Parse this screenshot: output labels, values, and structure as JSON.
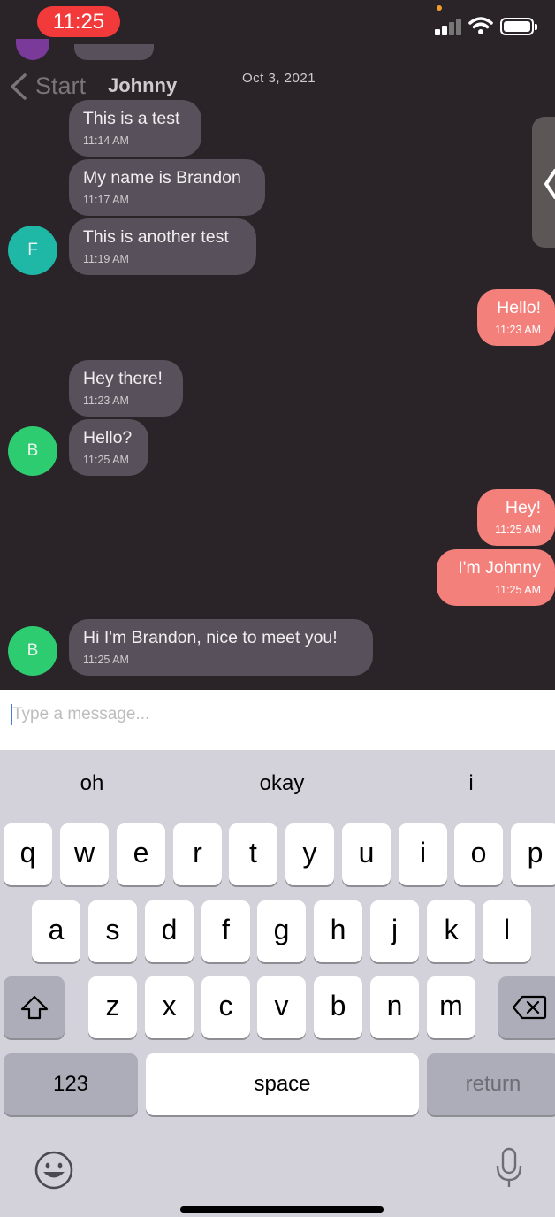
{
  "status_bar": {
    "time": "11:25"
  },
  "header": {
    "back_label": "Start",
    "title": "Johnny",
    "date": "Oct 3, 2021"
  },
  "messages": [
    {
      "side": "in",
      "text": "This is a test",
      "time": "11:14 AM"
    },
    {
      "side": "in",
      "text": "My name is Brandon",
      "time": "11:17 AM"
    },
    {
      "side": "in",
      "text": "This is another test",
      "time": "11:19 AM",
      "avatar": "F"
    },
    {
      "side": "out",
      "text": "Hello!",
      "time": "11:23 AM"
    },
    {
      "side": "in",
      "text": "Hey there!",
      "time": "11:23 AM"
    },
    {
      "side": "in",
      "text": "Hello?",
      "time": "11:25 AM",
      "avatar": "B"
    },
    {
      "side": "out",
      "text": "Hey!",
      "time": "11:25 AM"
    },
    {
      "side": "out",
      "text": "I'm Johnny",
      "time": "11:25 AM"
    },
    {
      "side": "in",
      "text": "Hi I'm Brandon, nice to meet you!",
      "time": "11:25 AM",
      "avatar": "B"
    }
  ],
  "colors": {
    "incoming": "#58505a",
    "outgoing": "#f3807a",
    "avatar_f": "#1fb8a6",
    "avatar_b": "#2ecc71",
    "background": "#2a2328"
  },
  "input": {
    "placeholder": "Type a message..."
  },
  "keyboard": {
    "suggestions": [
      "oh",
      "okay",
      "i"
    ],
    "row1": [
      "q",
      "w",
      "e",
      "r",
      "t",
      "y",
      "u",
      "i",
      "o",
      "p"
    ],
    "row2": [
      "a",
      "s",
      "d",
      "f",
      "g",
      "h",
      "j",
      "k",
      "l"
    ],
    "row3": [
      "z",
      "x",
      "c",
      "v",
      "b",
      "n",
      "m"
    ],
    "numbers": "123",
    "space": "space",
    "return": "return"
  }
}
